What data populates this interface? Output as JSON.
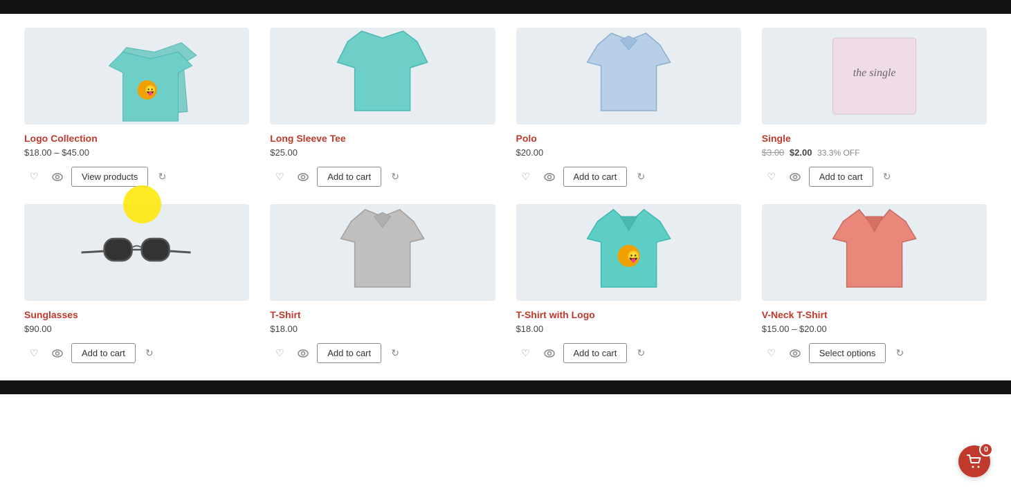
{
  "blackBars": true,
  "products": {
    "row1": [
      {
        "id": "logo-collection",
        "name": "Logo Collection",
        "price": "$18.00 – $45.00",
        "priceOriginal": null,
        "priceSale": null,
        "discount": null,
        "actionLabel": "View products",
        "actionType": "view",
        "imageType": "tshirt-logo-stack"
      },
      {
        "id": "long-sleeve-tee",
        "name": "Long Sleeve Tee",
        "price": "$25.00",
        "priceOriginal": null,
        "priceSale": null,
        "discount": null,
        "actionLabel": "Add to cart",
        "actionType": "cart",
        "imageType": "long-sleeve"
      },
      {
        "id": "polo",
        "name": "Polo",
        "price": "$20.00",
        "priceOriginal": null,
        "priceSale": null,
        "discount": null,
        "actionLabel": "Add to cart",
        "actionType": "cart",
        "imageType": "polo"
      },
      {
        "id": "single",
        "name": "Single",
        "price": null,
        "priceOriginal": "$3.00",
        "priceSale": "$2.00",
        "discount": "33.3% OFF",
        "actionLabel": "Add to cart",
        "actionType": "cart",
        "imageType": "single-text"
      }
    ],
    "row2": [
      {
        "id": "sunglasses",
        "name": "Sunglasses",
        "price": "$90.00",
        "priceOriginal": null,
        "priceSale": null,
        "discount": null,
        "actionLabel": "Add to cart",
        "actionType": "cart",
        "imageType": "sunglasses"
      },
      {
        "id": "t-shirt",
        "name": "T-Shirt",
        "price": "$18.00",
        "priceOriginal": null,
        "priceSale": null,
        "discount": null,
        "actionLabel": "Add to cart",
        "actionType": "cart",
        "imageType": "tshirt-gray"
      },
      {
        "id": "t-shirt-logo",
        "name": "T-Shirt with Logo",
        "price": "$18.00",
        "priceOriginal": null,
        "priceSale": null,
        "discount": null,
        "actionLabel": "Add to cart",
        "actionType": "cart",
        "imageType": "tshirt-logo"
      },
      {
        "id": "vneck-tshirt",
        "name": "V-Neck T-Shirt",
        "price": "$15.00 – $20.00",
        "priceOriginal": null,
        "priceSale": null,
        "discount": null,
        "actionLabel": "Select options",
        "actionType": "options",
        "imageType": "tshirt-salmon"
      }
    ]
  },
  "cart": {
    "count": "0"
  },
  "icons": {
    "heart": "♡",
    "eye": "👁",
    "refresh": "↻",
    "cart": "🛒"
  }
}
